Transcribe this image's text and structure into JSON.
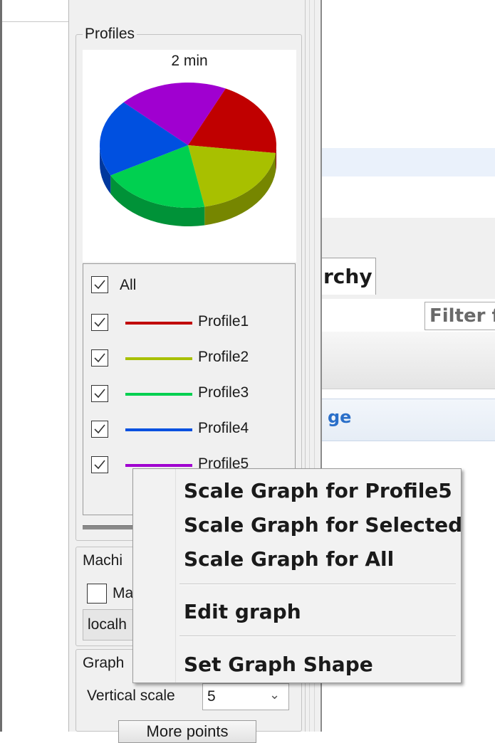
{
  "background": {
    "tab_label": "rchy",
    "filter_placeholder": "Filter f",
    "band_text": "ge"
  },
  "profiles_panel": {
    "title": "Profiles",
    "chart_title": "2 min",
    "all_label": "All",
    "profiles": [
      {
        "label": "Profile1",
        "color": "#c00000",
        "checked": true
      },
      {
        "label": "Profile2",
        "color": "#a8c000",
        "checked": true
      },
      {
        "label": "Profile3",
        "color": "#00d050",
        "checked": true
      },
      {
        "label": "Profile4",
        "color": "#0050e0",
        "checked": true
      },
      {
        "label": "Profile5",
        "color": "#a000d0",
        "checked": true
      }
    ]
  },
  "machine_panel": {
    "title": "Machi",
    "checkbox_label": "Ma",
    "host_value": "localh"
  },
  "graph_panel": {
    "title": "Graph",
    "vertical_scale_label": "Vertical scale",
    "vertical_scale_value": "5",
    "more_points_label": "More points"
  },
  "context_menu": {
    "items": [
      "Scale Graph for Profile5",
      "Scale Graph for Selected",
      "Scale Graph for All",
      "Edit graph",
      "Set Graph Shape"
    ]
  },
  "chart_data": {
    "type": "pie",
    "title": "2 min",
    "categories": [
      "Profile1",
      "Profile2",
      "Profile3",
      "Profile4",
      "Profile5"
    ],
    "values": [
      20,
      20,
      20,
      20,
      20
    ],
    "colors": [
      "#c00000",
      "#a8c000",
      "#00d050",
      "#0050e0",
      "#a000d0"
    ],
    "style": "3d"
  }
}
